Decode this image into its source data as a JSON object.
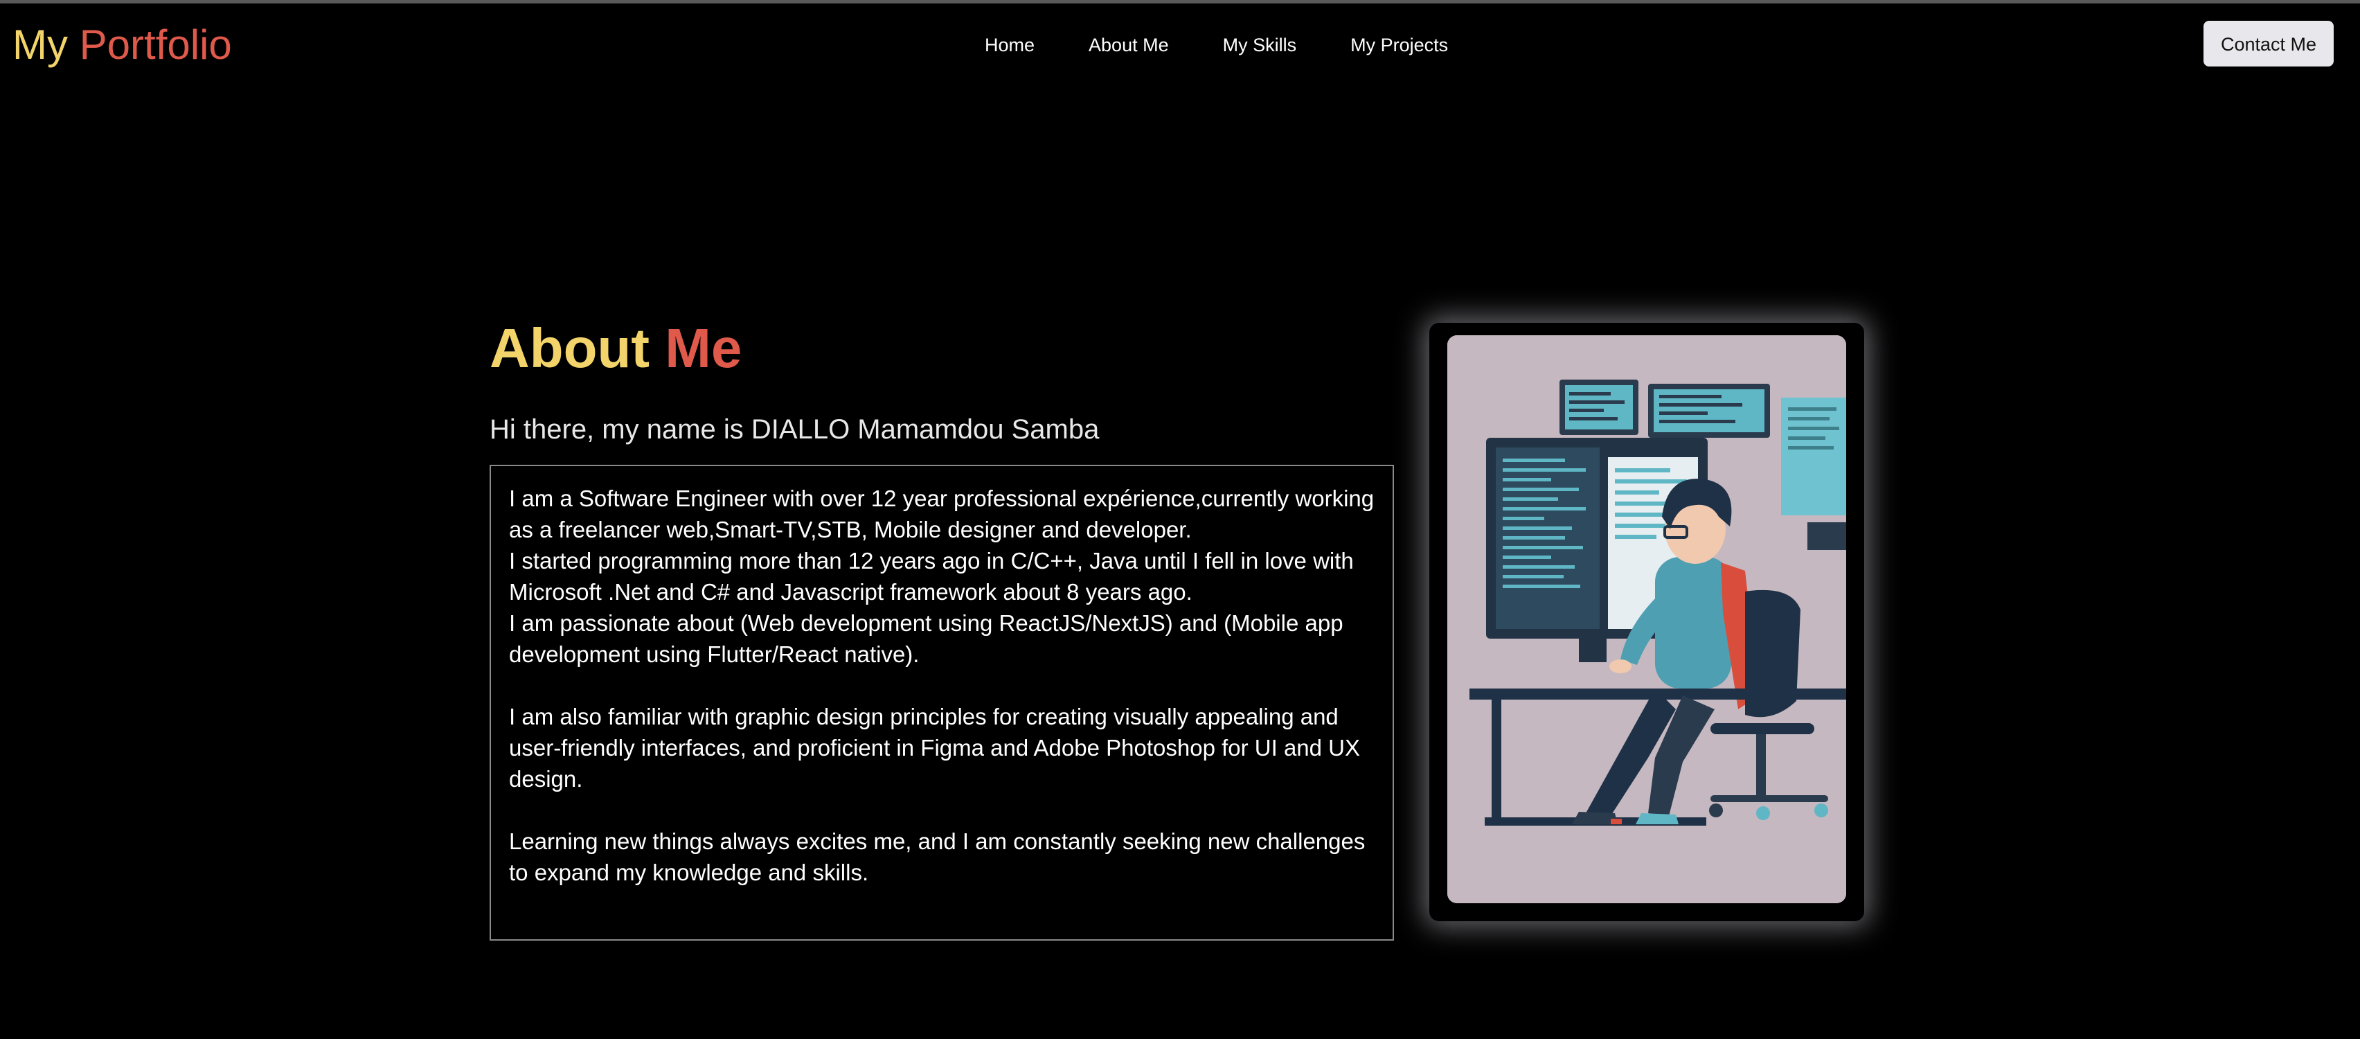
{
  "header": {
    "logo_first": "My",
    "logo_second": "Portfolio",
    "nav": [
      "Home",
      "About Me",
      "My Skills",
      "My Projects"
    ],
    "contact_label": "Contact Me"
  },
  "about": {
    "title_first": "About",
    "title_second": "Me",
    "greeting": "Hi there, my name is DIALLO Mamamdou Samba",
    "bio": {
      "line1": "I am a Software Engineer with over 12 year professional expérience,currently working as a freelancer web,Smart-TV,STB, Mobile designer and developer.",
      "line2": "I started programming more than 12 years ago in C/C++, Java until I fell in love with Microsoft .Net and C# and Javascript framework about 8 years ago.",
      "line3": "I am passionate about (Web development using ReactJS/NextJS) and (Mobile app development using Flutter/React native).",
      "line4": "I am also familiar with graphic design principles for creating visually appealing and user-friendly interfaces, and proficient in Figma and Adobe Photoshop for UI and UX design.",
      "line5": "Learning new things always excites me, and I am constantly seeking new challenges to expand my knowledge and skills."
    },
    "image_icon": "developer-at-desk-illustration"
  },
  "colors": {
    "background": "#000000",
    "yellow": "#f3d46b",
    "red": "#e05a4c",
    "button_bg": "#e8e8ec"
  }
}
